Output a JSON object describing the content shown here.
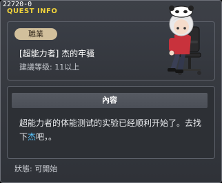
{
  "window": {
    "quest_id": "22720-0",
    "title": "QUEST INFO"
  },
  "quest": {
    "job_badge": "職業",
    "name": "[超能力者] 杰的牢骚",
    "recommend_level": "建議等级: 11以上",
    "portrait_icon": "character-portrait-in-gaming-chair"
  },
  "content": {
    "header": "內容",
    "text_before": "超能力者的体能测试的实验已经顺利开始了。去找下",
    "npc_name": "杰",
    "text_after": "吧，。"
  },
  "status": {
    "text": "狀態:  可開始"
  },
  "colors": {
    "title": "#f1d33a",
    "npc_highlight": "#59c6ff",
    "badge": "#d2c09c"
  }
}
